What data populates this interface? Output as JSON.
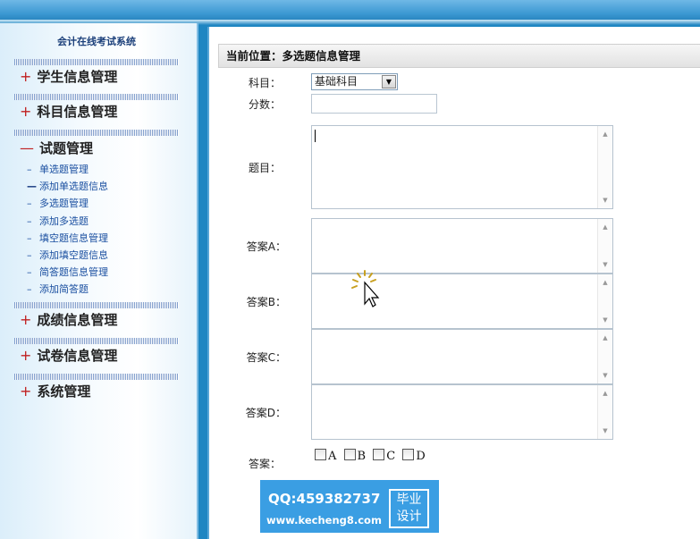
{
  "sidebar": {
    "title": "会计在线考试系统",
    "menus": [
      {
        "sign": "+",
        "label": "学生信息管理"
      },
      {
        "sign": "+",
        "label": "科目信息管理"
      },
      {
        "sign": "—",
        "label": "试题管理"
      },
      {
        "sign": "+",
        "label": "成绩信息管理"
      },
      {
        "sign": "+",
        "label": "试卷信息管理"
      },
      {
        "sign": "+",
        "label": "系统管理"
      }
    ],
    "sub_items": [
      "单选题管理",
      "添加单选题信息",
      "多选题管理",
      "添加多选题",
      "填空题信息管理",
      "添加填空题信息",
      "简答题信息管理",
      "添加简答题"
    ]
  },
  "main": {
    "breadcrumb": "当前位置：多选题信息管理",
    "form": {
      "subject_label": "科目：",
      "subject_value": "基础科目",
      "score_label": "分数：",
      "score_value": "",
      "question_label": "题目：",
      "answer_a_label": "答案A：",
      "answer_b_label": "答案B：",
      "answer_c_label": "答案C：",
      "answer_d_label": "答案D：",
      "answer_label": "答案：",
      "options": [
        "A",
        "B",
        "C",
        "D"
      ]
    }
  },
  "watermark": {
    "qq": "QQ:459382737",
    "url": "www.kecheng8.com",
    "badge_line1": "毕业",
    "badge_line2": "设计"
  }
}
